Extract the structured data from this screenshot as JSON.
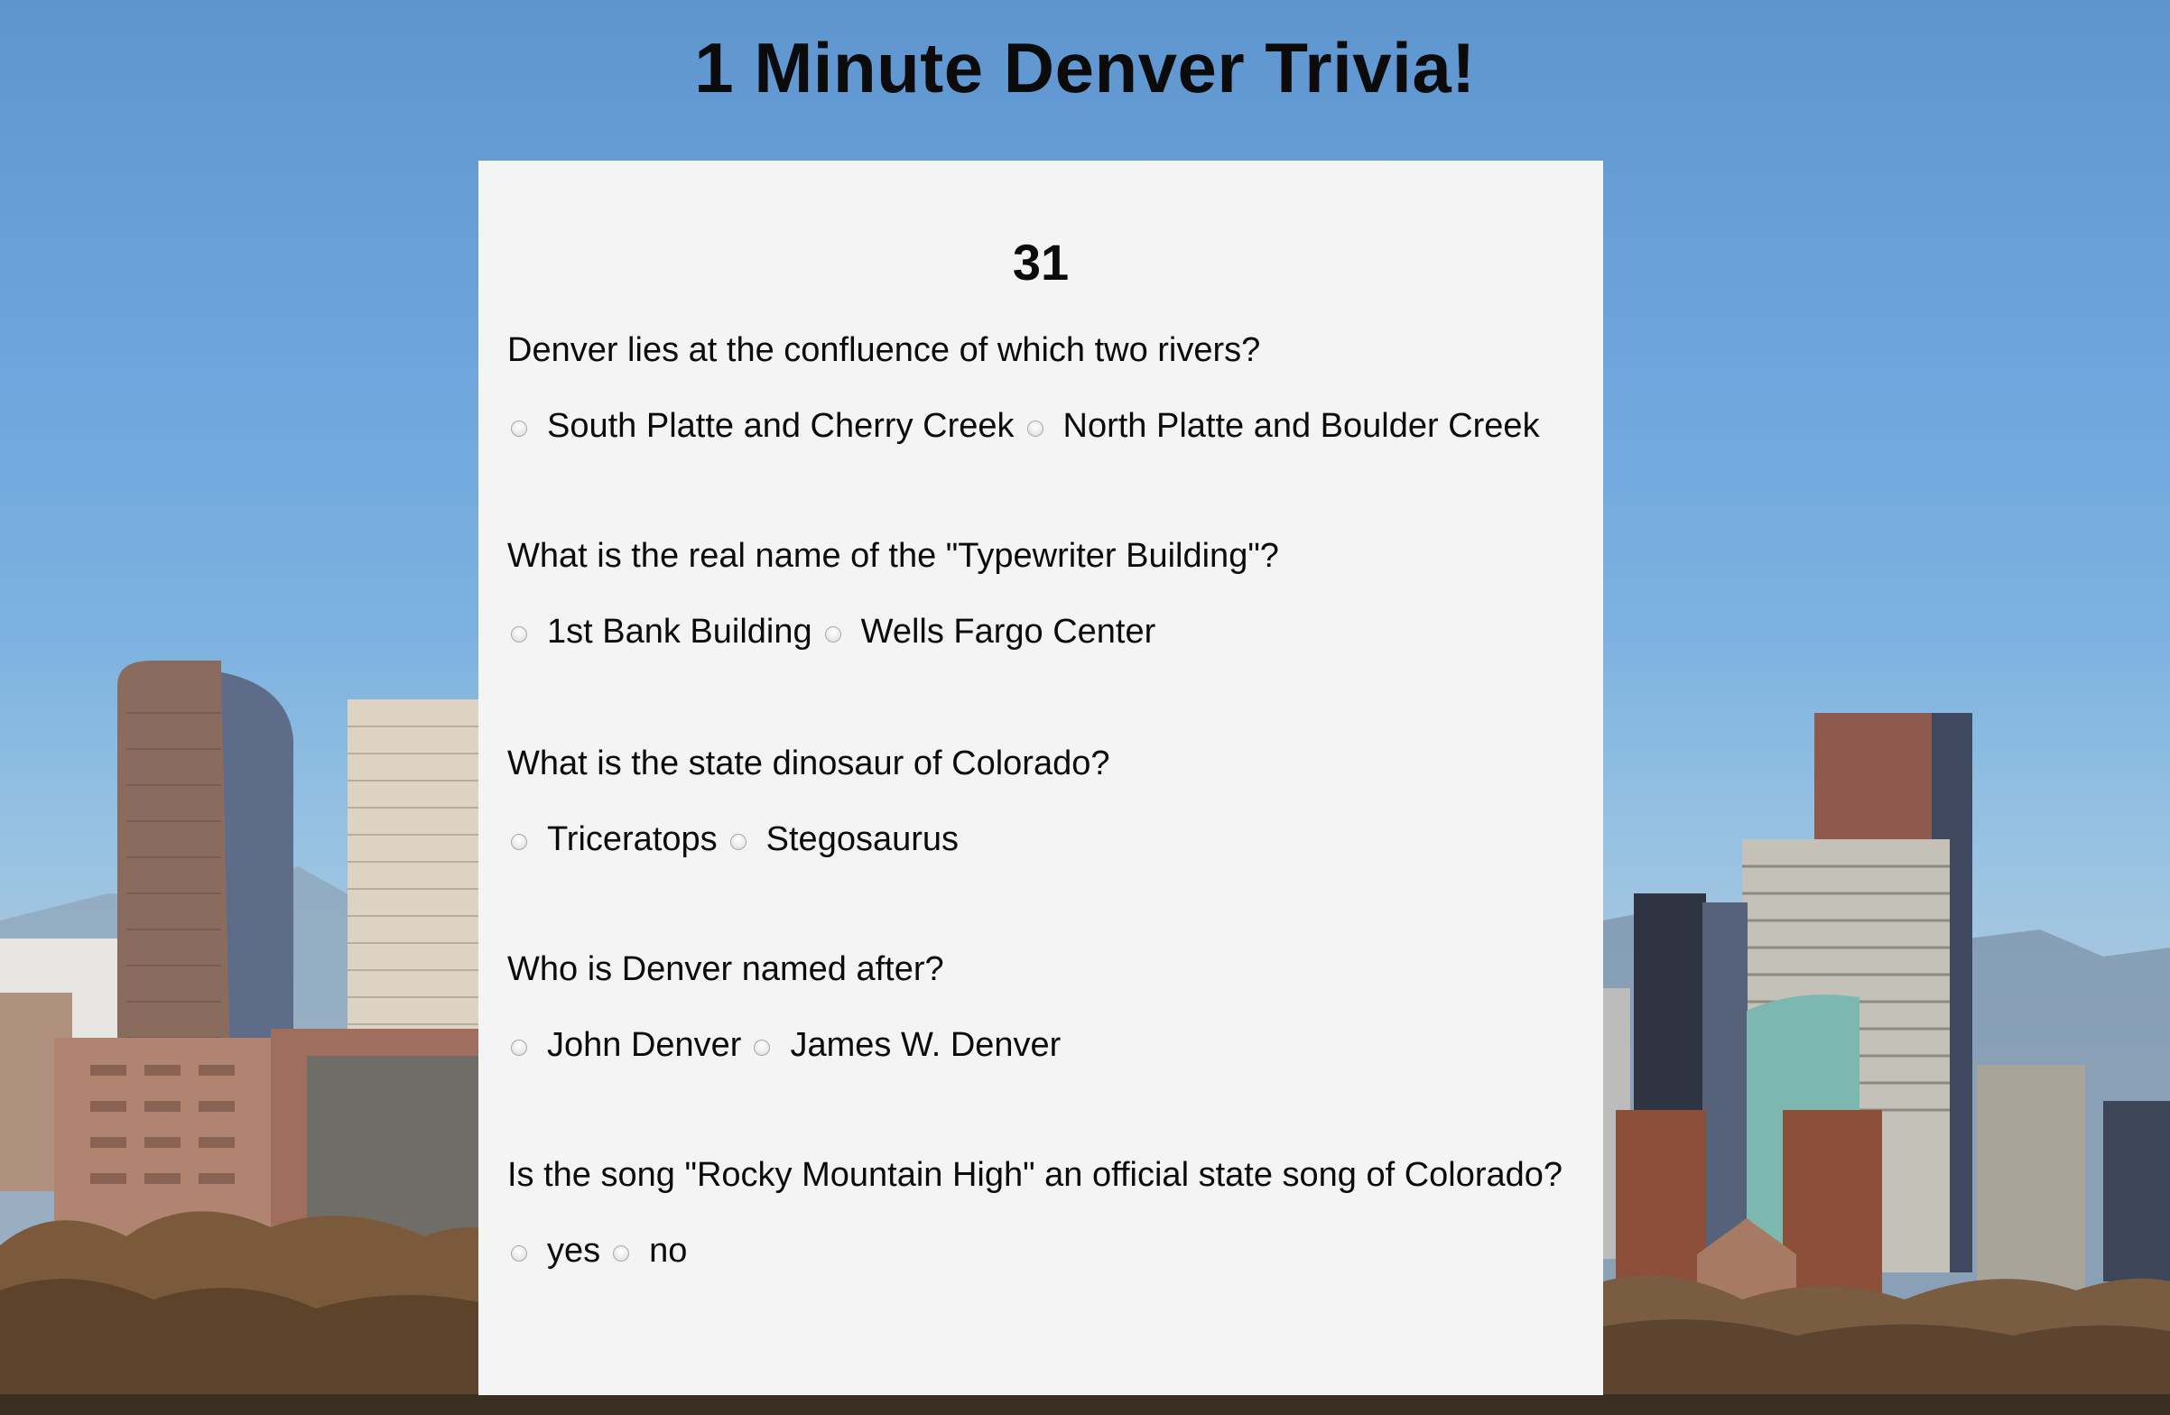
{
  "page": {
    "title": "1 Minute Denver Trivia!",
    "background": "Denver skyline"
  },
  "quiz": {
    "timer": "31",
    "questions": [
      {
        "question": "Denver lies at the confluence of which two rivers?",
        "answers": [
          "South Platte and Cherry Creek",
          "North Platte and Boulder Creek"
        ]
      },
      {
        "question": "What is the real name of the \"Typewriter Building\"?",
        "answers": [
          "1st Bank Building",
          "Wells Fargo Center"
        ]
      },
      {
        "question": "What is the state dinosaur of Colorado?",
        "answers": [
          "Triceratops",
          "Stegosaurus"
        ]
      },
      {
        "question": "Who is Denver named after?",
        "answers": [
          "John Denver",
          "James W. Denver"
        ]
      },
      {
        "question": "Is the song \"Rocky Mountain High\" an official state song of Colorado?",
        "answers": [
          "yes",
          "no"
        ]
      }
    ]
  },
  "colors": {
    "panel_background": "#f4f4f4",
    "text": "#0b0b0b",
    "sky": "#6aa3dc"
  },
  "icons": {
    "radio": "radio-button-unchecked-icon"
  }
}
